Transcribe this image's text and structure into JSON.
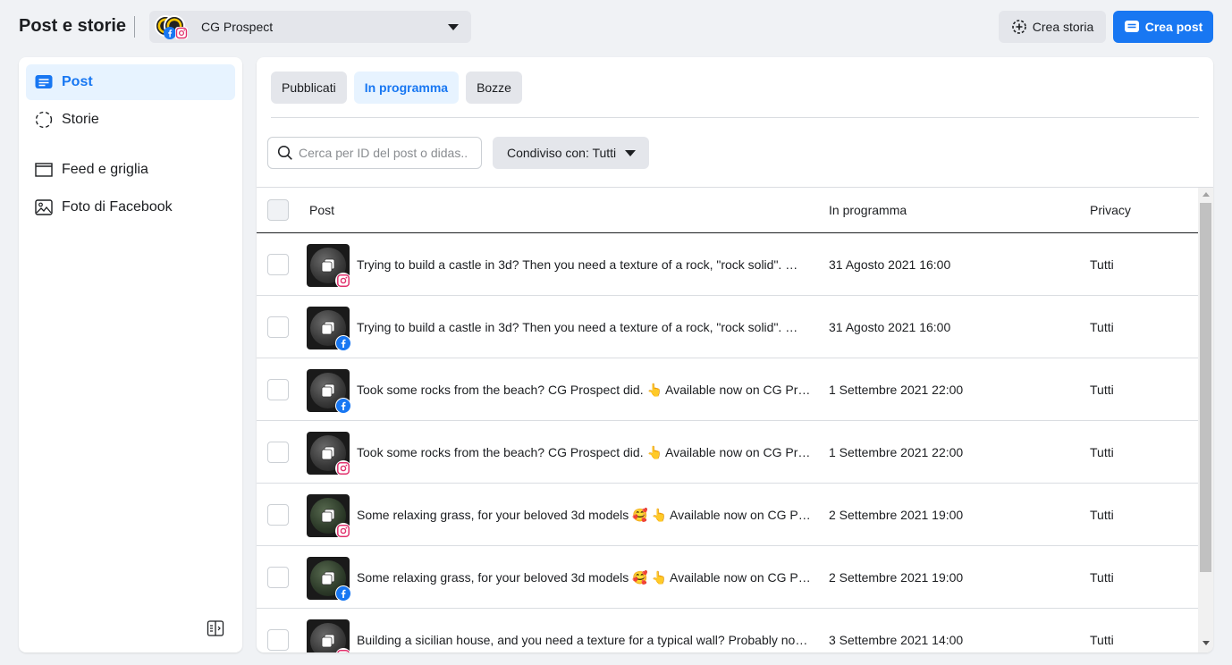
{
  "header": {
    "title": "Post e storie",
    "account": "CG Prospect",
    "create_story_label": "Crea storia",
    "create_post_label": "Crea post"
  },
  "sidebar": {
    "items": [
      {
        "label": "Post",
        "icon": "post-icon"
      },
      {
        "label": "Storie",
        "icon": "stories-icon"
      },
      {
        "label": "Feed e griglia",
        "icon": "feed-grid-icon"
      },
      {
        "label": "Foto di Facebook",
        "icon": "photos-icon"
      }
    ]
  },
  "tabs": [
    {
      "label": "Pubblicati"
    },
    {
      "label": "In programma"
    },
    {
      "label": "Bozze"
    }
  ],
  "search": {
    "placeholder": "Cerca per ID del post o didas..."
  },
  "filter": {
    "label": "Condiviso con: Tutti"
  },
  "table": {
    "columns": [
      "Post",
      "In programma",
      "Privacy"
    ],
    "rows": [
      {
        "caption": "Trying to build a castle in 3d? Then you need a texture of a rock, \"rock solid\". 🤓...",
        "date": "31 Agosto 2021 16:00",
        "privacy": "Tutti",
        "platform": "instagram"
      },
      {
        "caption": "Trying to build a castle in 3d? Then you need a texture of a rock, \"rock solid\". 🤓...",
        "date": "31 Agosto 2021 16:00",
        "privacy": "Tutti",
        "platform": "facebook"
      },
      {
        "caption": "Took some rocks from the beach? CG Prospect did. 👆 Available now on CG Pro...",
        "date": "1 Settembre 2021 22:00",
        "privacy": "Tutti",
        "platform": "facebook"
      },
      {
        "caption": "Took some rocks from the beach? CG Prospect did. 👆 Available now on CG Pro...",
        "date": "1 Settembre 2021 22:00",
        "privacy": "Tutti",
        "platform": "instagram"
      },
      {
        "caption": "Some relaxing grass, for your beloved 3d models 🥰 👆 Available now on CG Pr...",
        "date": "2 Settembre 2021 19:00",
        "privacy": "Tutti",
        "platform": "instagram"
      },
      {
        "caption": "Some relaxing grass, for your beloved 3d models 🥰 👆 Available now on CG Pr...",
        "date": "2 Settembre 2021 19:00",
        "privacy": "Tutti",
        "platform": "facebook"
      },
      {
        "caption": "Building a sicilian house, and you need a texture for a typical wall? Probably not....",
        "date": "3 Settembre 2021 14:00",
        "privacy": "Tutti",
        "platform": "instagram"
      }
    ]
  },
  "colors": {
    "accent": "#1877f2",
    "active_bg": "#e7f3ff",
    "instagram": "#e1306c",
    "facebook": "#1877f2"
  }
}
